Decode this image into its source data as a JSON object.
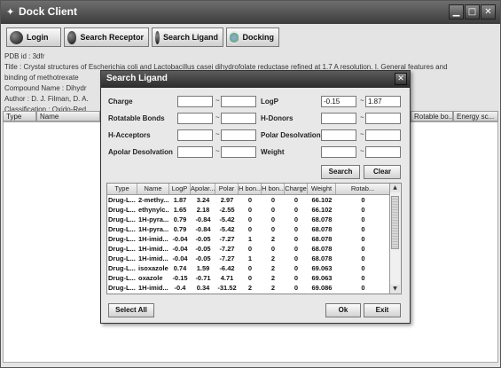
{
  "window": {
    "title": "Dock Client"
  },
  "toolbar": {
    "login": "Login",
    "search_receptor": "Search Receptor",
    "search_ligand": "Search Ligand",
    "docking": "Docking"
  },
  "info": {
    "pdb_id": "PDB id : 3dfr",
    "title": "Title : Crystal structures of Escherichia coli and Lactobacillus casei dihydrofolate reductase refined at 1.7 A resolution. I. General features and",
    "title_cont": "binding of methotrexate",
    "compound": "Compound Name : Dihydr",
    "author": "Author : D. J. Filman, D. A.",
    "classification": "Classification : Oxido-Red"
  },
  "bg_table": {
    "headers": [
      "Type",
      "Name",
      "Rotable bo...",
      "Energy sc..."
    ]
  },
  "dialog": {
    "title": "Search Ligand",
    "fields": {
      "charge": "Charge",
      "logp": "LogP",
      "rotatable_bonds": "Rotatable Bonds",
      "h_donors": "H-Donors",
      "h_acceptors": "H-Acceptors",
      "polar_desolvation": "Polar Desolvation",
      "apolar_desolvation": "Apolar Desolvation",
      "weight": "Weight"
    },
    "range_sep": "~",
    "logp_min": "-0.15",
    "logp_max": "1.87",
    "search": "Search",
    "clear": "Clear",
    "select_all": "Select All",
    "ok": "Ok",
    "exit": "Exit",
    "columns": [
      "Type",
      "Name",
      "LogP",
      "Apolar...",
      "Polar",
      "H bon...",
      "H bon...",
      "Charge",
      "Weight",
      "Rotab..."
    ],
    "rows": [
      [
        "Drug-L...",
        "2-methy...",
        "1.87",
        "3.24",
        "2.97",
        "0",
        "0",
        "0",
        "66.102",
        "0"
      ],
      [
        "Drug-L...",
        "ethynylc...",
        "1.65",
        "2.18",
        "-2.55",
        "0",
        "0",
        "0",
        "66.102",
        "0"
      ],
      [
        "Drug-L...",
        "1H-pyra...",
        "0.79",
        "-0.84",
        "-5.42",
        "0",
        "0",
        "0",
        "68.078",
        "0"
      ],
      [
        "Drug-L...",
        "1H-pyra...",
        "0.79",
        "-0.84",
        "-5.42",
        "0",
        "0",
        "0",
        "68.078",
        "0"
      ],
      [
        "Drug-L...",
        "1H-imid...",
        "-0.04",
        "-0.05",
        "-7.27",
        "1",
        "2",
        "0",
        "68.078",
        "0"
      ],
      [
        "Drug-L...",
        "1H-imid...",
        "-0.04",
        "-0.05",
        "-7.27",
        "0",
        "0",
        "0",
        "68.078",
        "0"
      ],
      [
        "Drug-L...",
        "1H-imid...",
        "-0.04",
        "-0.05",
        "-7.27",
        "1",
        "2",
        "0",
        "68.078",
        "0"
      ],
      [
        "Drug-L...",
        "isoxazole",
        "0.74",
        "1.59",
        "-6.42",
        "0",
        "2",
        "0",
        "69.063",
        "0"
      ],
      [
        "Drug-L...",
        "oxazole",
        "-0.15",
        "-0.71",
        "4.71",
        "0",
        "2",
        "0",
        "69.063",
        "0"
      ],
      [
        "Drug-L...",
        "1H-imid...",
        "-0.4",
        "0.34",
        "-31.52",
        "2",
        "2",
        "0",
        "69.086",
        "0"
      ]
    ]
  }
}
